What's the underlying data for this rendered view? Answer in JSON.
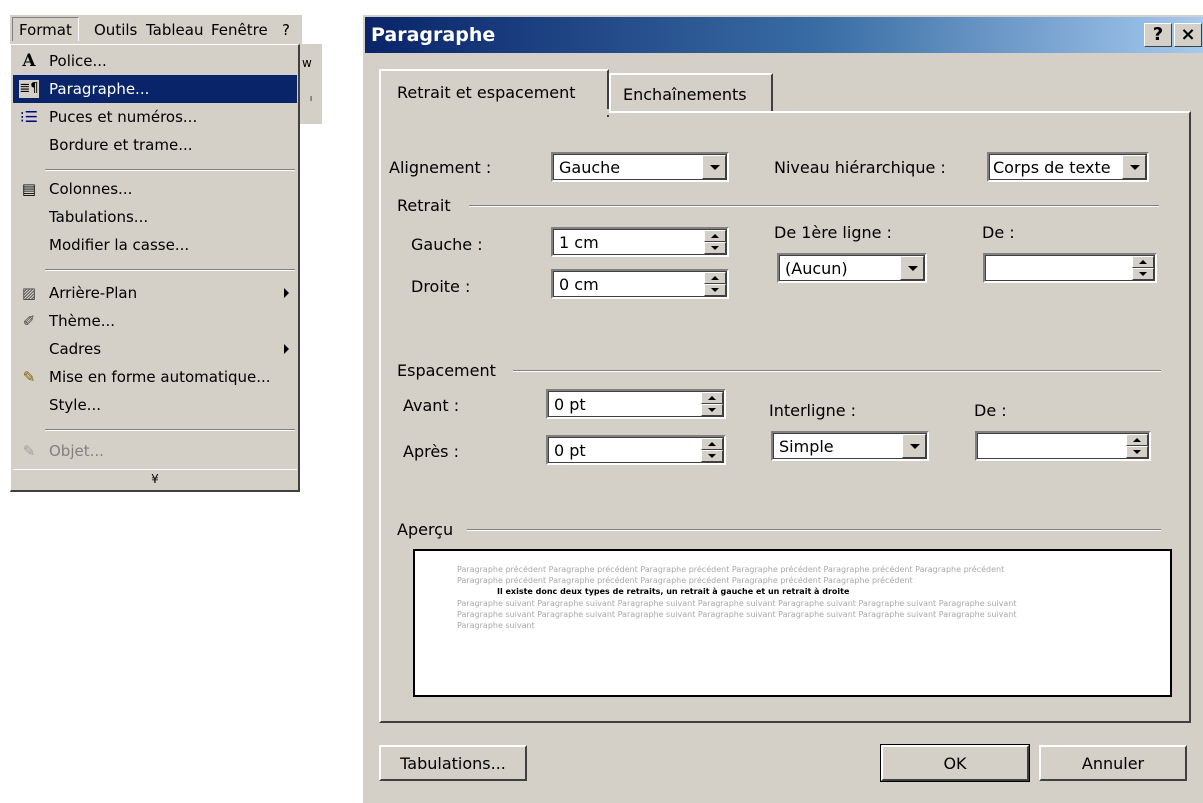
{
  "menubar": {
    "items": [
      "Format",
      "Outils",
      "Tableau",
      "Fenêtre",
      "?"
    ],
    "background_text": [
      "w",
      "ˡ"
    ]
  },
  "format_menu": {
    "items": [
      {
        "label": "Police...",
        "icon": "font-A-icon"
      },
      {
        "label": "Paragraphe...",
        "icon": "paragraph-icon",
        "selected": true
      },
      {
        "label": "Puces et numéros...",
        "icon": "bullets-icon"
      },
      {
        "label": "Bordure et trame...",
        "icon": ""
      },
      {
        "label": "Colonnes...",
        "icon": "columns-icon"
      },
      {
        "label": "Tabulations...",
        "icon": ""
      },
      {
        "label": "Modifier la casse...",
        "icon": ""
      },
      {
        "label": "Arrière-Plan",
        "icon": "background-icon",
        "submenu": true
      },
      {
        "label": "Thème...",
        "icon": "theme-icon"
      },
      {
        "label": "Cadres",
        "icon": "",
        "submenu": true
      },
      {
        "label": "Mise en forme automatique...",
        "icon": "autoformat-icon"
      },
      {
        "label": "Style...",
        "icon": ""
      },
      {
        "label": "Objet...",
        "icon": "object-icon",
        "disabled": true
      }
    ],
    "expand_glyph": "¥"
  },
  "dialog": {
    "title": "Paragraphe",
    "help_button": "?",
    "close_button": "×",
    "tabs": [
      "Retrait et espacement",
      "Enchaînements"
    ],
    "alignment": {
      "label": "Alignement :",
      "value": "Gauche"
    },
    "outline_level": {
      "label": "Niveau hiérarchique :",
      "value": "Corps de texte"
    },
    "indent": {
      "group_label": "Retrait",
      "left_label": "Gauche :",
      "left_value": "1 cm",
      "right_label": "Droite :",
      "right_value": "0 cm",
      "first_line_label": "De 1ère ligne :",
      "first_line_value": "(Aucun)",
      "by_label": "De :",
      "by_value": ""
    },
    "spacing": {
      "group_label": "Espacement",
      "before_label": "Avant :",
      "before_value": "0 pt",
      "after_label": "Après :",
      "after_value": "0 pt",
      "line_label": "Interligne :",
      "line_value": "Simple",
      "at_label": "De :",
      "at_value": ""
    },
    "preview": {
      "group_label": "Aperçu",
      "lines": [
        "Paragraphe précédent Paragraphe précédent Paragraphe précédent Paragraphe précédent Paragraphe précédent Paragraphe précédent",
        "Paragraphe précédent Paragraphe précédent Paragraphe précédent Paragraphe précédent Paragraphe précédent",
        "Il existe donc deux types de retraits, un retrait à gauche et un retrait à droite",
        "Paragraphe suivant Paragraphe suivant Paragraphe suivant Paragraphe suivant Paragraphe suivant Paragraphe suivant Paragraphe suivant",
        "Paragraphe suivant Paragraphe suivant Paragraphe suivant Paragraphe suivant Paragraphe suivant Paragraphe suivant Paragraphe suivant",
        "Paragraphe suivant"
      ]
    },
    "buttons": {
      "tabs": "Tabulations...",
      "ok": "OK",
      "cancel": "Annuler"
    }
  }
}
